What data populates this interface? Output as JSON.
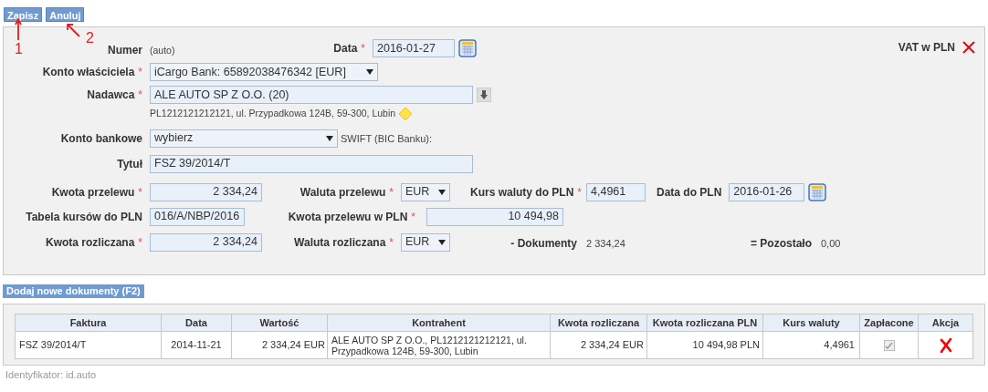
{
  "toolbar": {
    "buttons": [
      {
        "label": "Zapisz"
      },
      {
        "label": "Anuluj"
      }
    ]
  },
  "annotations": [
    {
      "label": "1"
    },
    {
      "label": "2"
    }
  ],
  "form": {
    "numer": {
      "label": "Numer",
      "value": "(auto)"
    },
    "data": {
      "label": "Data",
      "mark": "*",
      "value": "2016-01-27"
    },
    "vat": {
      "label": "VAT w PLN",
      "checked": false
    },
    "konto_wlasciciela": {
      "label": "Konto właściciela",
      "mark": "*",
      "value": "iCargo Bank: 65892038476342 [EUR]"
    },
    "nadawca": {
      "label": "Nadawca",
      "mark": "*",
      "value": "ALE AUTO SP Z O.O. (20)",
      "address": "PL1212121212121, ul. Przypadkowa 124B, 59-300, Lubin"
    },
    "konto_bankowe": {
      "label": "Konto bankowe",
      "value": "wybierz",
      "swift": "SWIFT (BIC Banku):"
    },
    "tytul": {
      "label": "Tytuł",
      "value": "FSZ 39/2014/T"
    },
    "kwota_przelewu": {
      "label": "Kwota przelewu",
      "mark": "*",
      "value": "2 334,24"
    },
    "waluta_przelewu": {
      "label": "Waluta przelewu",
      "mark": "*",
      "value": "EUR"
    },
    "kurs_waluty": {
      "label": "Kurs waluty do PLN",
      "mark": "*",
      "value": "4,4961"
    },
    "data_do_pln": {
      "label": "Data do PLN",
      "value": "2016-01-26"
    },
    "tabela_kursow": {
      "label": "Tabela kursów do PLN",
      "value": "016/A/NBP/2016"
    },
    "kwota_przelewu_pln": {
      "label": "Kwota przelewu w PLN",
      "mark": "*",
      "value": "10 494,98"
    },
    "kwota_rozliczana": {
      "label": "Kwota rozliczana",
      "mark": "*",
      "value": "2 334,24"
    },
    "waluta_rozliczana": {
      "label": "Waluta rozliczana",
      "mark": "*",
      "value": "EUR"
    },
    "dokumenty": {
      "label": "- Dokumenty",
      "value": "2 334,24"
    },
    "pozostalo": {
      "label": "= Pozostało",
      "value": "0,00"
    }
  },
  "add_button": {
    "label": "Dodaj nowe dokumenty (F2)"
  },
  "table": {
    "columns": [
      "Faktura",
      "Data",
      "Wartość",
      "Kontrahent",
      "Kwota rozliczana",
      "Kwota rozliczana PLN",
      "Kurs waluty",
      "Zapłacone",
      "Akcja"
    ],
    "rows": [
      {
        "faktura": "FSZ 39/2014/T",
        "data": "2014-11-21",
        "wartosc": "2 334,24 EUR",
        "kontrahent": "ALE AUTO SP Z O.O., PL1212121212121, ul. Przypadkowa 124B, 59-300, Lubin",
        "kwota": "2 334,24 EUR",
        "kwota_pln": "10 494,98 PLN",
        "kurs": "4,4961",
        "paid": true
      }
    ]
  },
  "footer": {
    "text": "Identyfikator: id.auto"
  }
}
